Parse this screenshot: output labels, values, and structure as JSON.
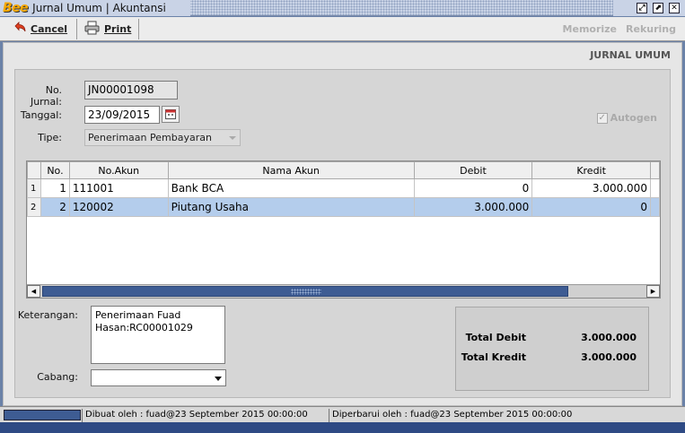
{
  "window": {
    "logo": "Bee",
    "title": "Jurnal Umum | Akuntansi",
    "buttons": {
      "restore": "⤢",
      "maximize": "⬈",
      "close": "✕"
    }
  },
  "toolbar": {
    "cancel_label": "Cancel",
    "print_label": "Print",
    "memorize_label": "Memorize",
    "rekuring_label": "Rekuring"
  },
  "form": {
    "heading": "JURNAL UMUM",
    "no_jurnal_label": "No. Jurnal:",
    "no_jurnal_value": "JN00001098",
    "tanggal_label": "Tanggal:",
    "tanggal_value": "23/09/2015",
    "tipe_label": "Tipe:",
    "tipe_value": "Penerimaan Pembayaran",
    "autogen_label": "Autogen",
    "autogen_checked": true
  },
  "grid": {
    "columns": [
      "No.",
      "No.Akun",
      "Nama Akun",
      "Debit",
      "Kredit"
    ],
    "rows": [
      {
        "rownum": "1",
        "no": "1",
        "akun": "111001",
        "nama": "Bank BCA",
        "debit": "0",
        "kredit": "3.000.000",
        "selected": false
      },
      {
        "rownum": "2",
        "no": "2",
        "akun": "120002",
        "nama": "Piutang Usaha",
        "debit": "3.000.000",
        "kredit": "0",
        "selected": true
      }
    ]
  },
  "keterangan": {
    "label": "Keterangan:",
    "line1": "Penerimaan Fuad",
    "line2": "Hasan:RC00001029"
  },
  "cabang": {
    "label": "Cabang:",
    "value": ""
  },
  "totals": {
    "debit_label": "Total Debit",
    "debit_value": "3.000.000",
    "kredit_label": "Total Kredit",
    "kredit_value": "3.000.000"
  },
  "status": {
    "created": "Dibuat oleh : fuad@23 September 2015  00:00:00",
    "updated": "Diperbarui oleh : fuad@23 September 2015  00:00:00"
  },
  "colors": {
    "accent": "#3e5c93",
    "selected_row": "#b4cdec",
    "logo": "#f7a800"
  }
}
